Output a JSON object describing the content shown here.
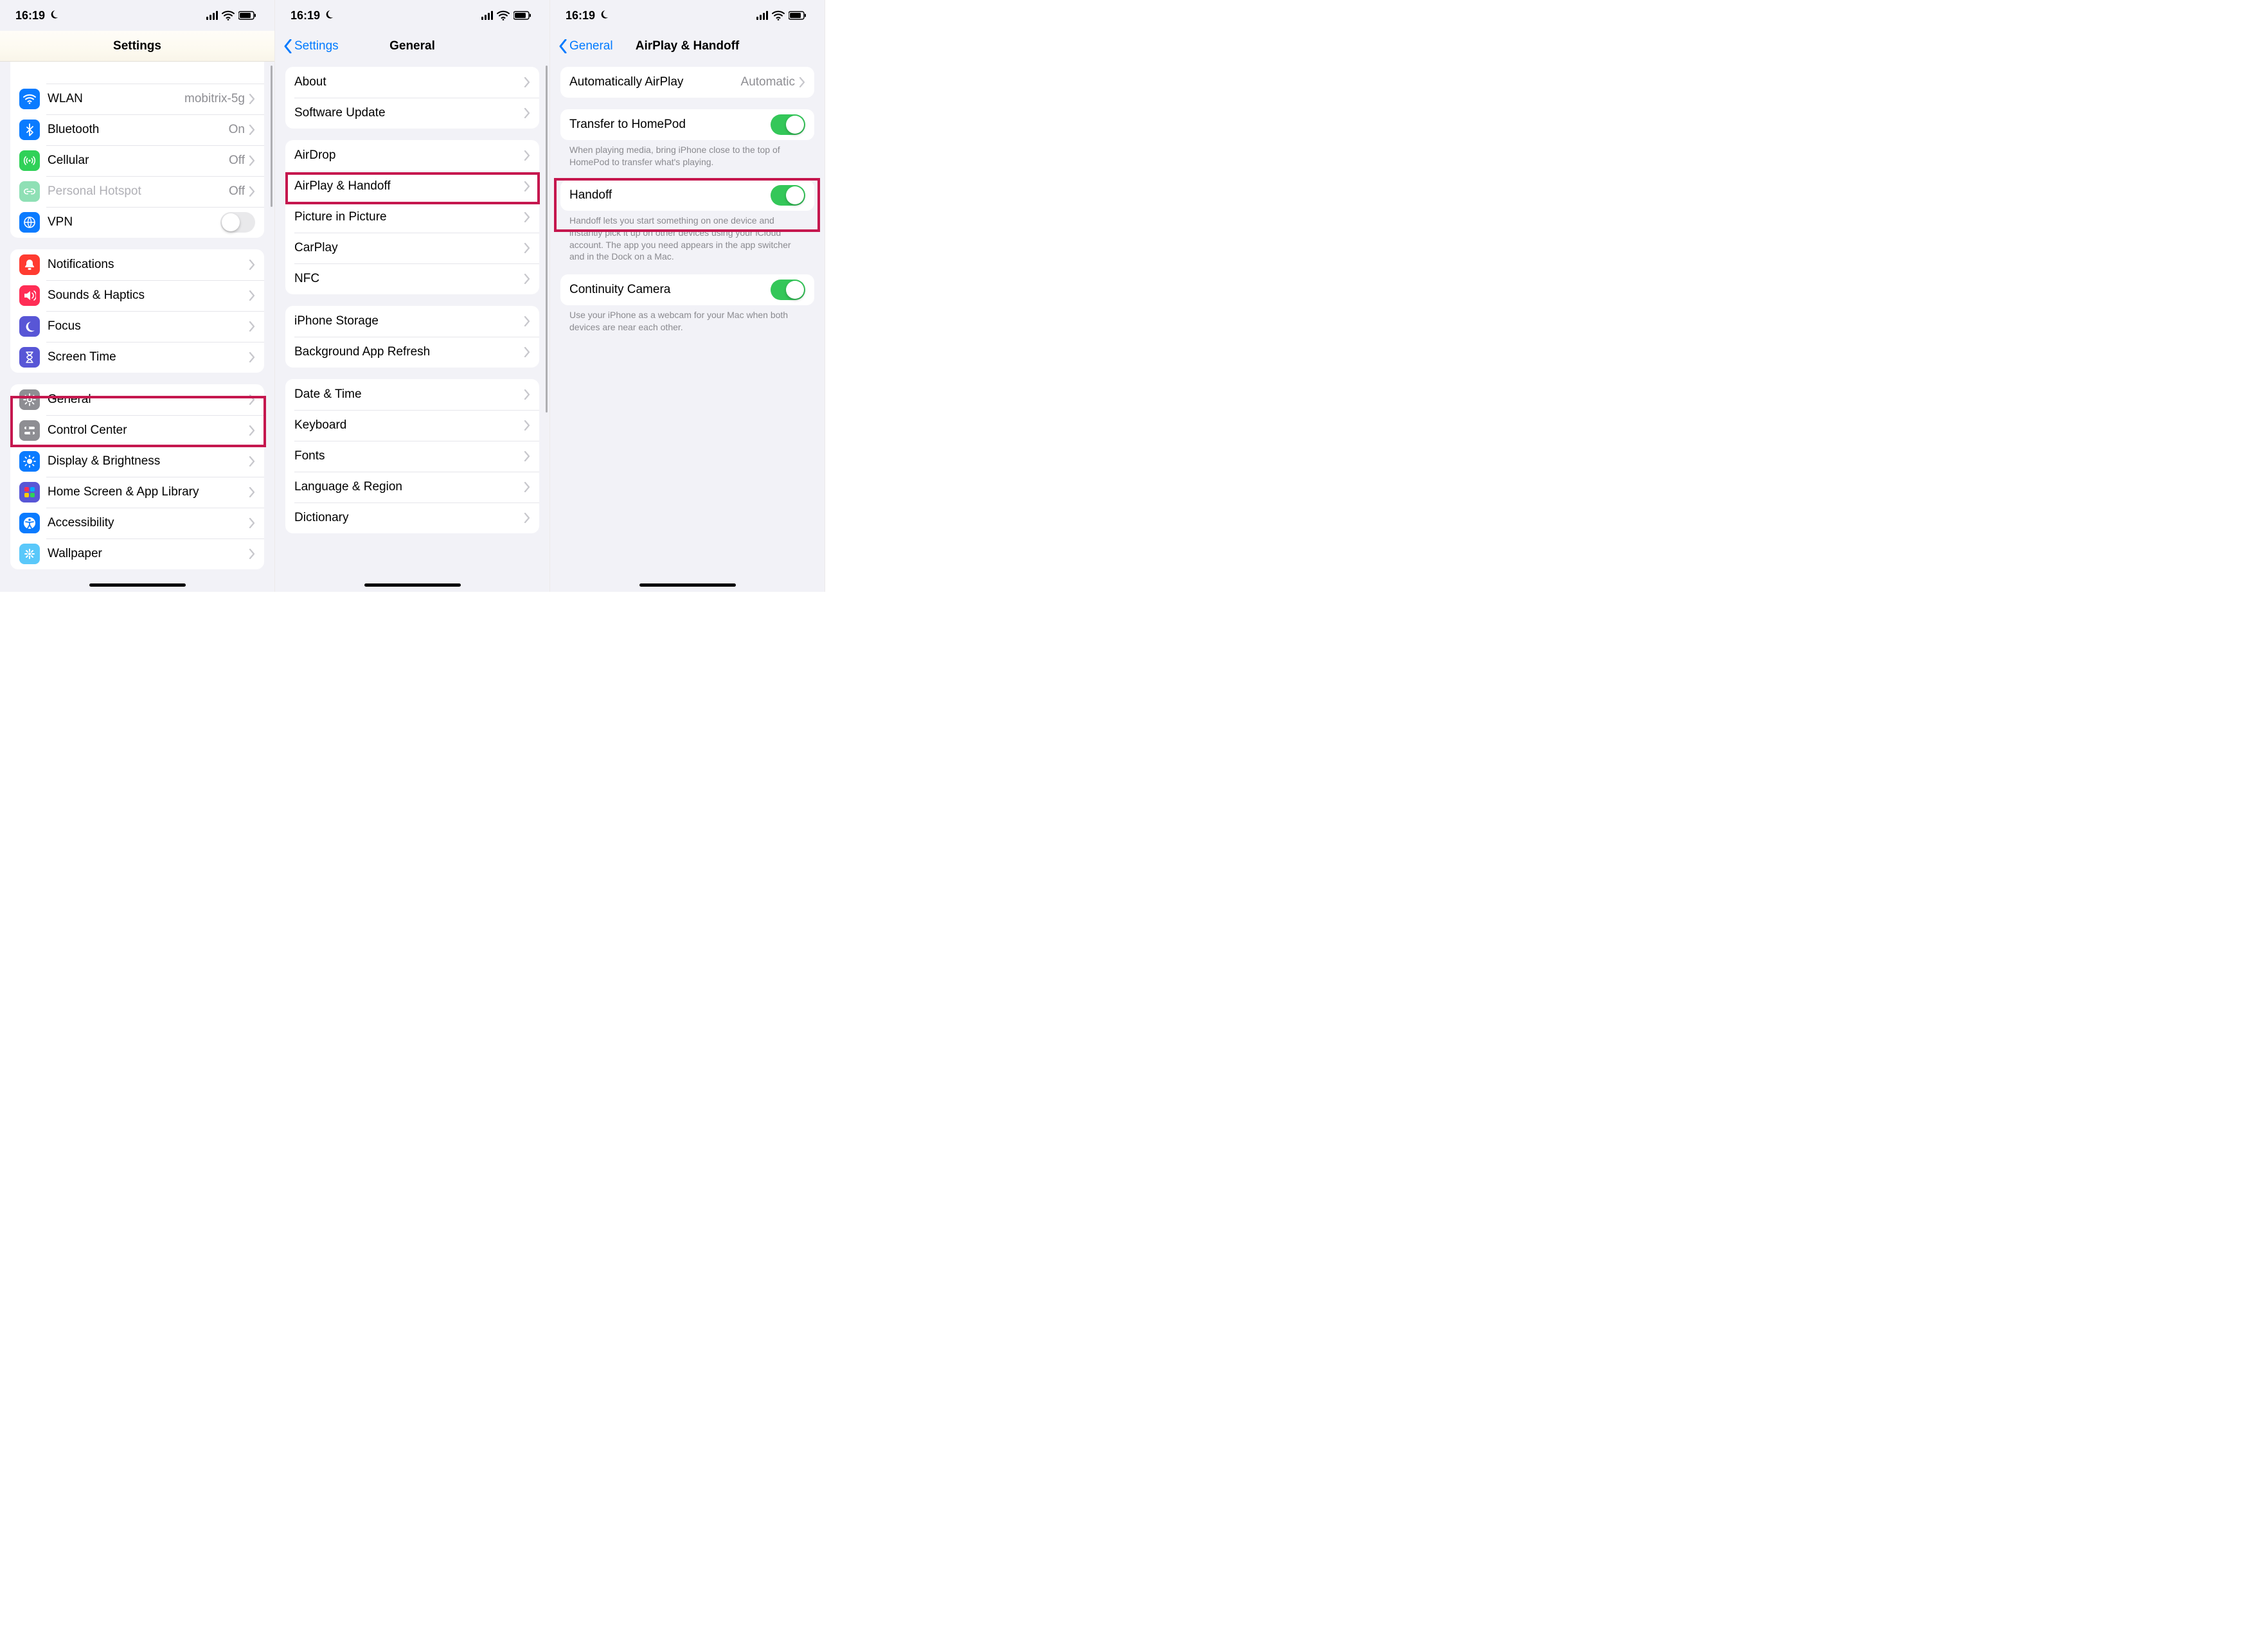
{
  "status": {
    "time": "16:19"
  },
  "screen1": {
    "title": "Settings",
    "network": {
      "wlan": {
        "label": "WLAN",
        "value": "mobitrix-5g"
      },
      "bluetooth": {
        "label": "Bluetooth",
        "value": "On"
      },
      "cellular": {
        "label": "Cellular",
        "value": "Off"
      },
      "hotspot": {
        "label": "Personal Hotspot",
        "value": "Off"
      },
      "vpn": {
        "label": "VPN"
      }
    },
    "attention": {
      "notifications": "Notifications",
      "sounds": "Sounds & Haptics",
      "focus": "Focus",
      "screentime": "Screen Time"
    },
    "general_group": {
      "general": "General",
      "control_center": "Control Center",
      "display": "Display & Brightness",
      "home_screen": "Home Screen & App Library",
      "accessibility": "Accessibility",
      "wallpaper": "Wallpaper"
    }
  },
  "screen2": {
    "back": "Settings",
    "title": "General",
    "g1": {
      "about": "About",
      "update": "Software Update"
    },
    "g2": {
      "airdrop": "AirDrop",
      "airplay": "AirPlay & Handoff",
      "pip": "Picture in Picture",
      "carplay": "CarPlay",
      "nfc": "NFC"
    },
    "g3": {
      "storage": "iPhone Storage",
      "bgrefresh": "Background App Refresh"
    },
    "g4": {
      "datetime": "Date & Time",
      "keyboard": "Keyboard",
      "fonts": "Fonts",
      "language": "Language & Region",
      "dictionary": "Dictionary"
    }
  },
  "screen3": {
    "back": "General",
    "title": "AirPlay & Handoff",
    "auto_airplay": {
      "label": "Automatically AirPlay",
      "value": "Automatic"
    },
    "transfer": {
      "label": "Transfer to HomePod",
      "on": true,
      "footer": "When playing media, bring iPhone close to the top of HomePod to transfer what's playing."
    },
    "handoff": {
      "label": "Handoff",
      "on": true,
      "footer": "Handoff lets you start something on one device and instantly pick it up on other devices using your iCloud account. The app you need appears in the app switcher and in the Dock on a Mac."
    },
    "continuity": {
      "label": "Continuity Camera",
      "on": true,
      "footer": "Use your iPhone as a webcam for your Mac when both devices are near each other."
    }
  }
}
